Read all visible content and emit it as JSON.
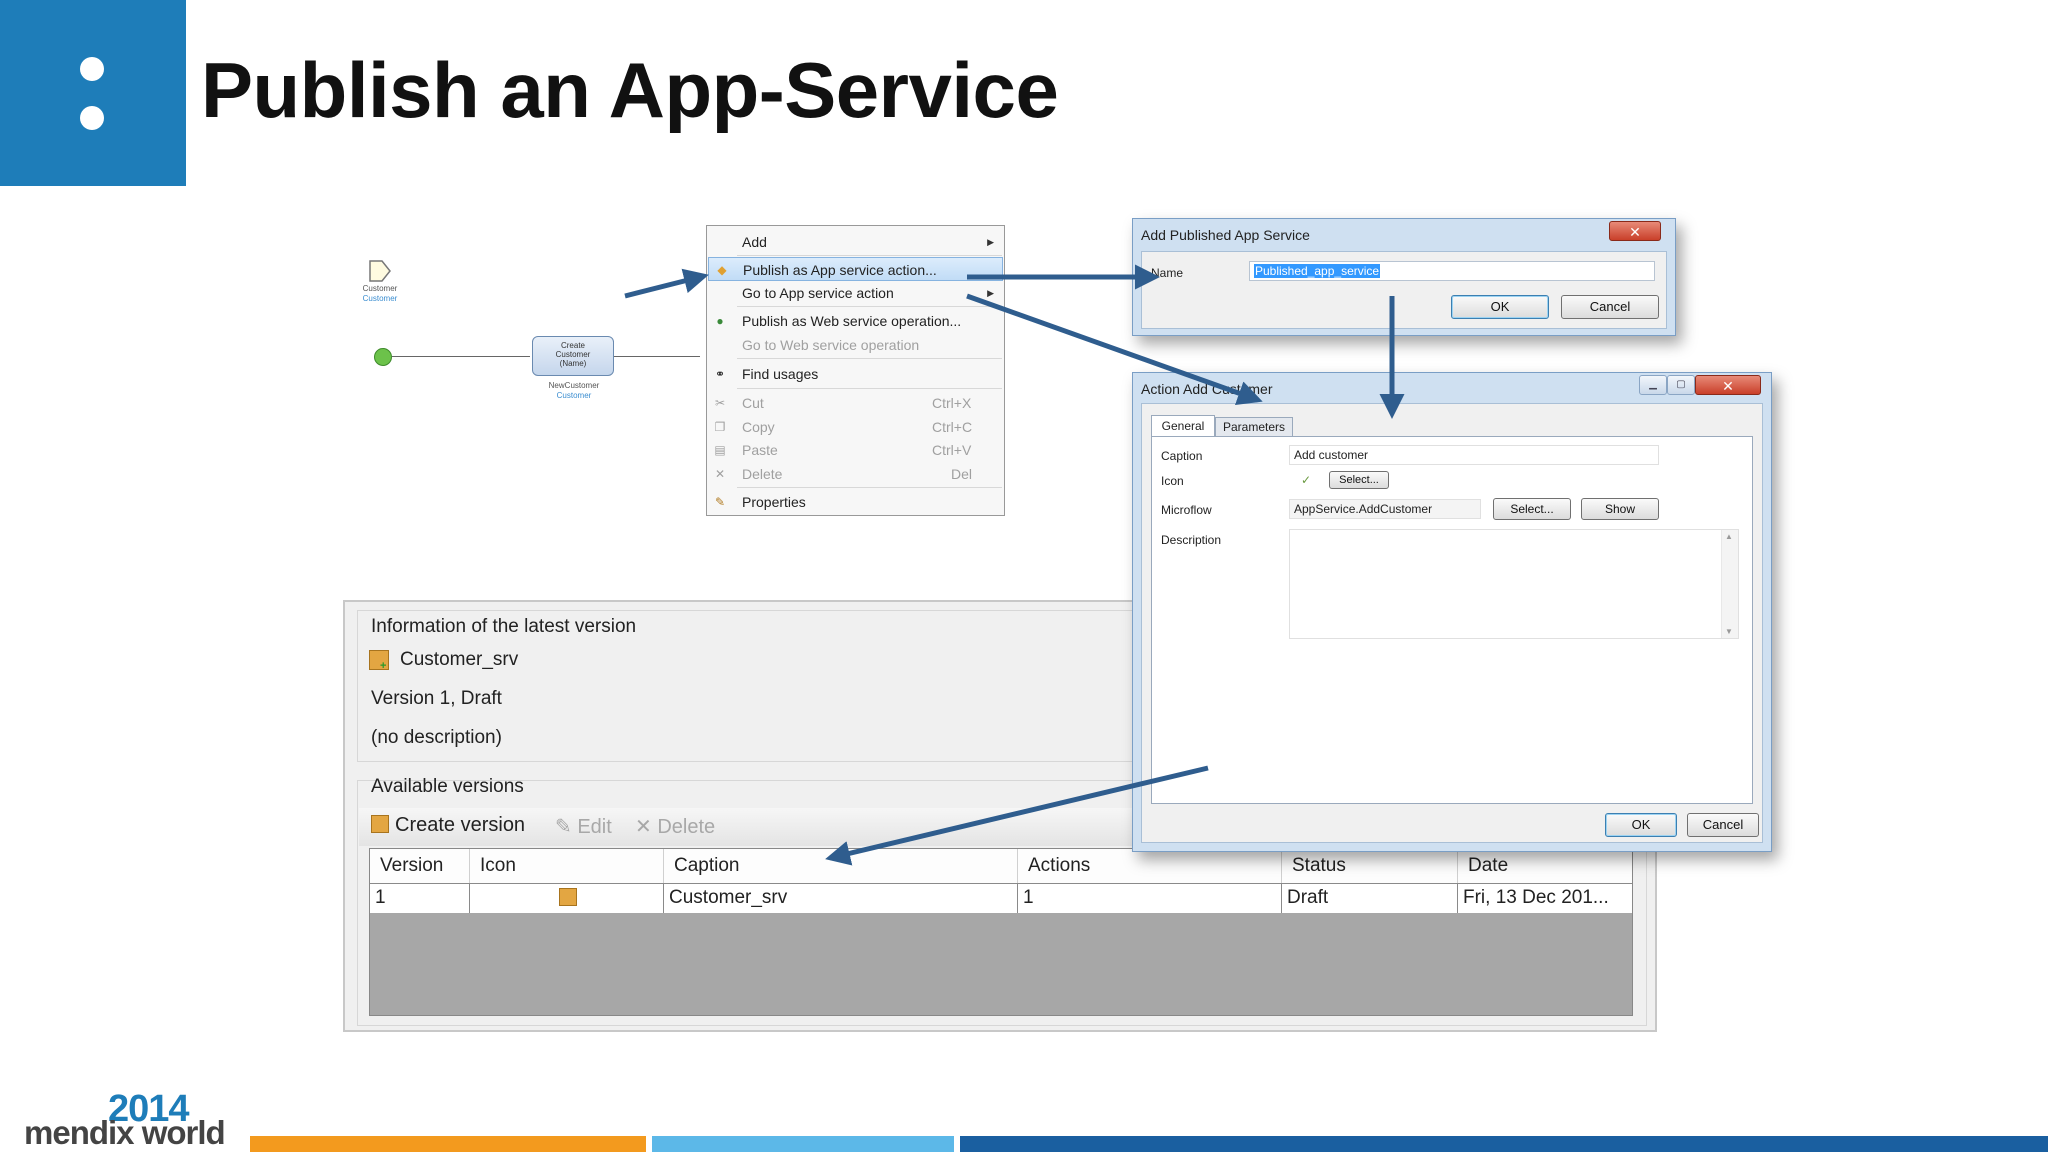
{
  "title": "Publish an App-Service",
  "colors": {
    "brand_blue": "#1e7db9",
    "arrow": "#2f5d8e",
    "bar_orange": "#f39a1e",
    "bar_light_blue": "#5cb8e8",
    "bar_dark_blue": "#1a5fa0"
  },
  "microflow": {
    "parameter_label": "Customer",
    "parameter_type": "Customer",
    "activity_line1": "Create",
    "activity_line2": "Customer",
    "activity_line3": "(Name)",
    "activity_output": "NewCustomer",
    "activity_output_type": "Customer"
  },
  "context_menu": {
    "items": [
      {
        "label": "Add",
        "shortcut": "",
        "icon": "none",
        "disabled": false,
        "submenu": true
      },
      {
        "label": "Publish as App service action...",
        "shortcut": "",
        "icon": "app-service-icon",
        "disabled": false,
        "highlighted": true
      },
      {
        "label": "Go to App service action",
        "shortcut": "",
        "icon": "none",
        "disabled": false,
        "submenu": true
      },
      {
        "label": "Publish as Web service operation...",
        "shortcut": "",
        "icon": "globe-icon",
        "disabled": false
      },
      {
        "label": "Go to Web service operation",
        "shortcut": "",
        "icon": "none",
        "disabled": true
      },
      {
        "label": "Find usages",
        "shortcut": "",
        "icon": "binoculars-icon",
        "disabled": false
      },
      {
        "label": "Cut",
        "shortcut": "Ctrl+X",
        "icon": "scissors-icon",
        "disabled": true
      },
      {
        "label": "Copy",
        "shortcut": "Ctrl+C",
        "icon": "copy-icon",
        "disabled": true
      },
      {
        "label": "Paste",
        "shortcut": "Ctrl+V",
        "icon": "paste-icon",
        "disabled": true
      },
      {
        "label": "Delete",
        "shortcut": "Del",
        "icon": "delete-icon",
        "disabled": true
      },
      {
        "label": "Properties",
        "shortcut": "",
        "icon": "properties-icon",
        "disabled": false
      }
    ]
  },
  "add_dialog": {
    "title": "Add Published App Service",
    "name_label": "Name",
    "name_value": "Published_app_service",
    "ok": "OK",
    "cancel": "Cancel"
  },
  "action_dialog": {
    "title": "Action Add Customer",
    "tabs": [
      "General",
      "Parameters"
    ],
    "caption_label": "Caption",
    "caption_value": "Add customer",
    "icon_label": "Icon",
    "icon_select": "Select...",
    "microflow_label": "Microflow",
    "microflow_value": "AppService.AddCustomer",
    "microflow_select": "Select...",
    "microflow_show": "Show",
    "description_label": "Description",
    "ok": "OK",
    "cancel": "Cancel"
  },
  "service_panel": {
    "info_heading": "Information of the latest version",
    "service_name": "Customer_srv",
    "version_text": "Version 1, Draft",
    "description": "(no description)",
    "versions_heading": "Available versions",
    "toolbar": {
      "create": "Create version",
      "edit": "Edit",
      "delete": "Delete"
    },
    "columns": [
      "Version",
      "Icon",
      "Caption",
      "Actions",
      "Status",
      "Date"
    ],
    "rows": [
      {
        "version": "1",
        "caption": "Customer_srv",
        "actions": "1",
        "status": "Draft",
        "date": "Fri, 13 Dec 201..."
      }
    ]
  },
  "footer": {
    "year": "2014",
    "brand": "mendix world"
  }
}
